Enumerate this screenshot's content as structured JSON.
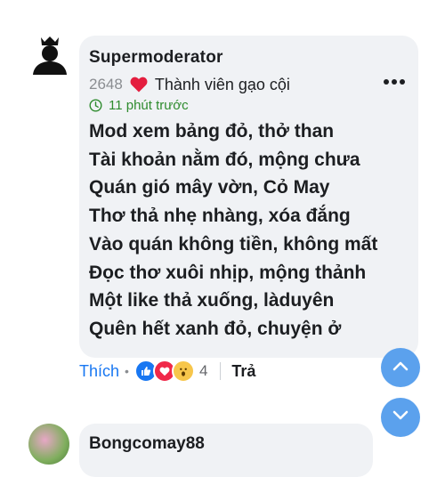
{
  "comment": {
    "username": "Supermoderator",
    "post_count": "2648",
    "rank": "Thành viên gạo cội",
    "time_ago": "11 phút trước",
    "lines": [
      "Mod xem bảng đỏ, thở than",
      "Tài khoản nằm đó, mộng chưa",
      "Quán gió mây vờn, Cỏ May",
      "Thơ thả nhẹ nhàng, xóa đắng",
      "Vào quán không tiền, không mất",
      "Đọc thơ xuôi nhịp, mộng thảnh",
      "Một like thả xuống, làduyên",
      "Quên hết xanh đỏ, chuyện ở"
    ]
  },
  "actions": {
    "like_label": "Thích",
    "separator": "•",
    "reaction_count": "4",
    "reply_label": "Trả"
  },
  "reactions": [
    "like-icon",
    "love-icon",
    "wow-icon"
  ],
  "next_comment": {
    "username": "Bongcomay88"
  },
  "colors": {
    "bubble": "#f0f2f5",
    "link_blue": "#1877f2",
    "time_green": "#2e8b2e",
    "heart_red": "#e41e3f",
    "scroll_button": "#5ba1ed"
  }
}
